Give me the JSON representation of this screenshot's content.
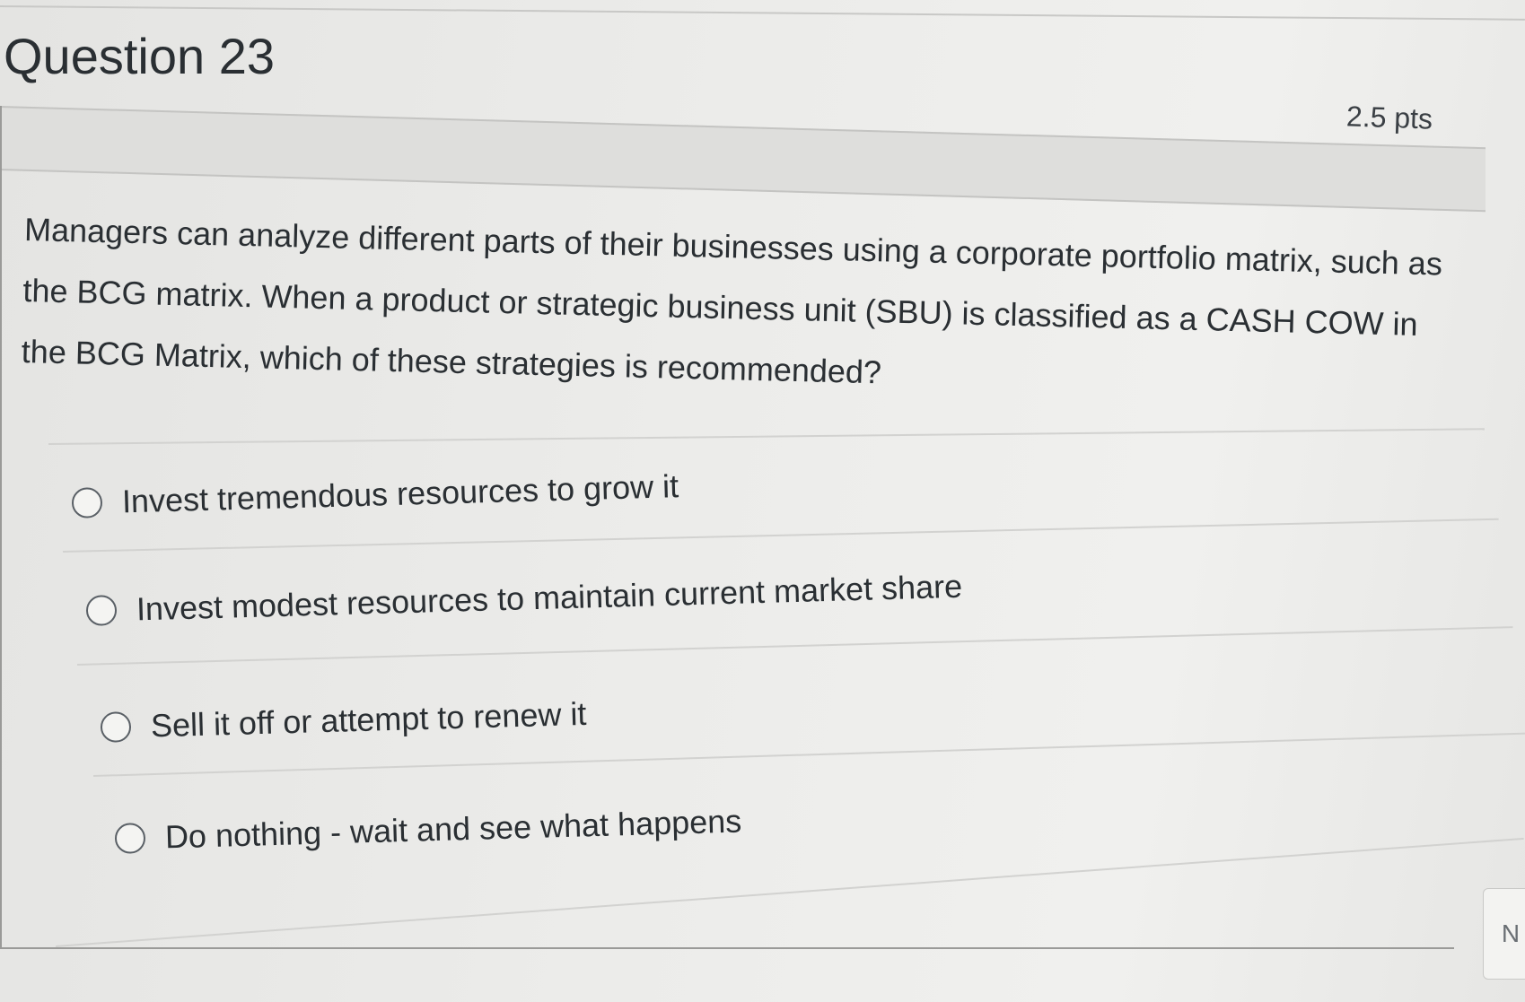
{
  "question": {
    "title": "Question 23",
    "points": "2.5 pts",
    "text": "Managers can analyze different parts of their businesses using a corporate portfolio matrix, such as the BCG matrix. When a product or strategic business unit (SBU) is classified as a CASH COW in the BCG Matrix, which of these strategies is recommended?"
  },
  "answers": [
    {
      "label": "Invest tremendous resources to grow it",
      "selected": false
    },
    {
      "label": "Invest modest resources to maintain current market share",
      "selected": false
    },
    {
      "label": "Sell it off or attempt to renew it",
      "selected": false
    },
    {
      "label": "Do nothing - wait and see what happens",
      "selected": false
    }
  ],
  "side_button": {
    "label": "N"
  }
}
